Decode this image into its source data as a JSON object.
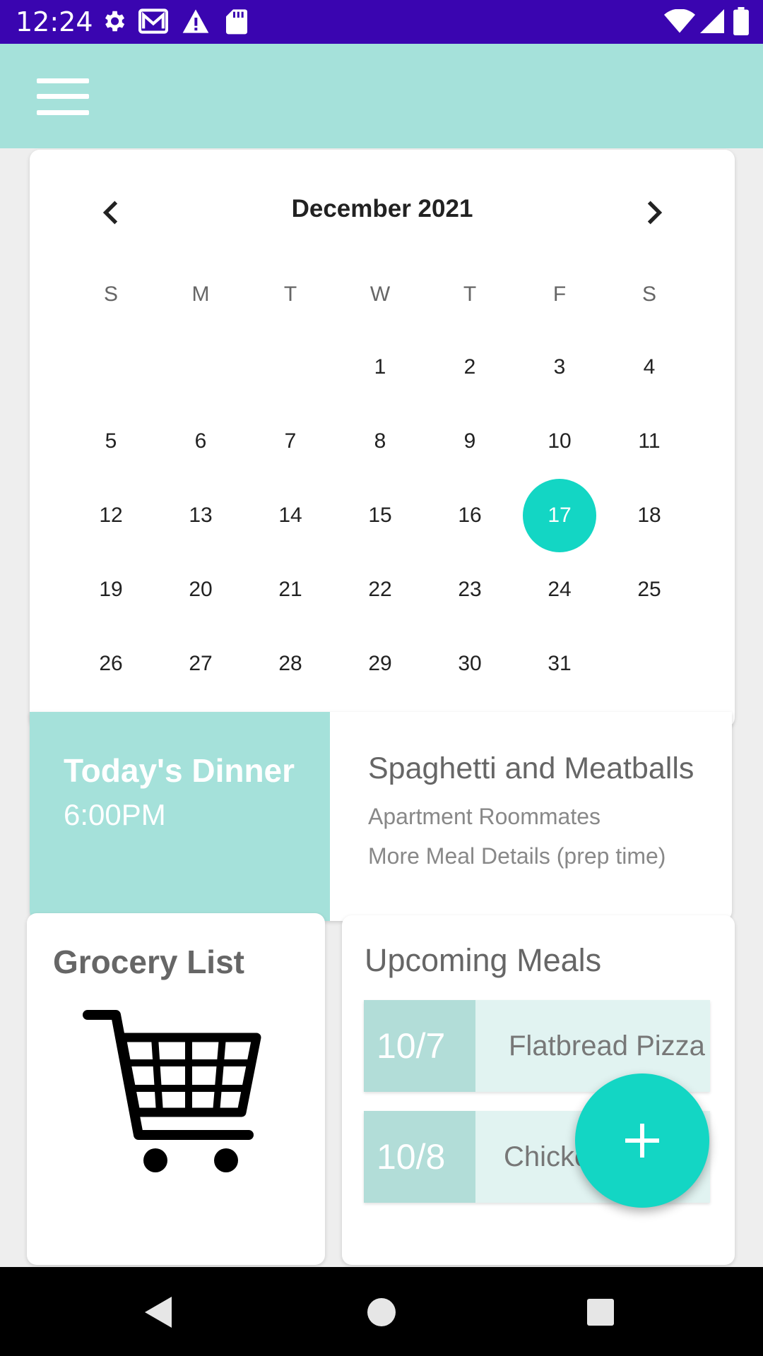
{
  "status_bar": {
    "time": "12:24",
    "left_icons": [
      "gear-icon",
      "gmail-icon",
      "warning-icon",
      "sd-card-icon"
    ],
    "right_icons": [
      "wifi-icon",
      "signal-icon",
      "battery-icon"
    ]
  },
  "app_bar": {
    "menu_icon": "menu-icon",
    "color": "#a5e1da"
  },
  "calendar": {
    "month_label": "December 2021",
    "weekdays": [
      "S",
      "M",
      "T",
      "W",
      "T",
      "F",
      "S"
    ],
    "first_weekday_index": 3,
    "days_in_month": 31,
    "selected_day": "17",
    "selected_color": "#13d6c4"
  },
  "dinner": {
    "title": "Today's Dinner",
    "time": "6:00PM",
    "meal_name": "Spaghetti and Meatballs",
    "group": "Apartment Roommates",
    "details": "More Meal Details (prep time)"
  },
  "grocery": {
    "title": "Grocery List",
    "icon": "shopping-cart-icon"
  },
  "upcoming": {
    "title": "Upcoming Meals",
    "meals": [
      {
        "date": "10/7",
        "name": "Flatbread Pizza"
      },
      {
        "date": "10/8",
        "name": "Chicke"
      }
    ]
  },
  "fab": {
    "icon": "plus-icon",
    "color": "#13d6c4"
  },
  "nav_bar": {
    "icons": [
      "back-icon",
      "home-icon",
      "recents-icon"
    ]
  }
}
